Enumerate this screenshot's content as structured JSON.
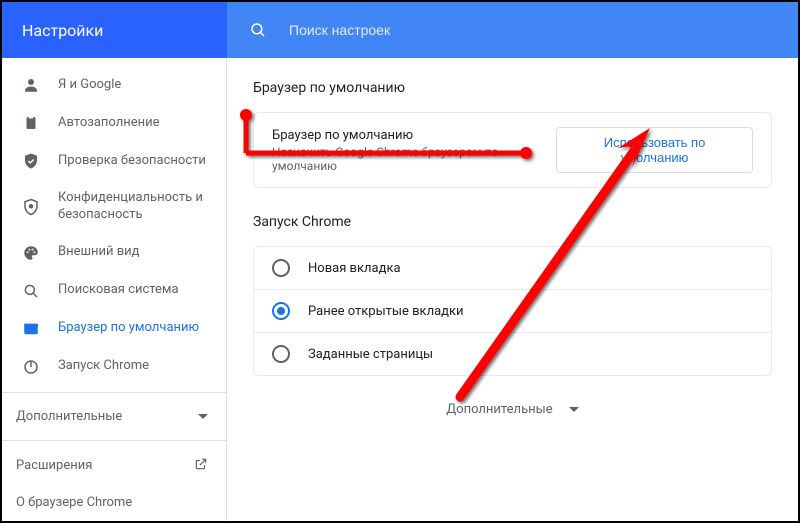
{
  "header": {
    "title": "Настройки",
    "search_placeholder": "Поиск настроек"
  },
  "sidebar": {
    "items": [
      {
        "label": "Я и Google",
        "icon": "person"
      },
      {
        "label": "Автозаполнение",
        "icon": "clipboard"
      },
      {
        "label": "Проверка безопасности",
        "icon": "shield-check"
      },
      {
        "label": "Конфиденциальность и безопасность",
        "icon": "shield"
      },
      {
        "label": "Внешний вид",
        "icon": "palette"
      },
      {
        "label": "Поисковая система",
        "icon": "search"
      },
      {
        "label": "Браузер по умолчанию",
        "icon": "browser",
        "active": true
      },
      {
        "label": "Запуск Chrome",
        "icon": "power"
      }
    ],
    "advanced_label": "Дополнительные",
    "extensions_label": "Расширения",
    "about_label": "О браузере Chrome"
  },
  "main": {
    "default_browser": {
      "section_title": "Браузер по умолчанию",
      "row_title": "Браузер по умолчанию",
      "row_subtitle": "Назначить Google Chrome браузером по умолчанию",
      "button_label": "Использовать по умолчанию"
    },
    "startup": {
      "section_title": "Запуск Chrome",
      "options": [
        {
          "label": "Новая вкладка",
          "checked": false
        },
        {
          "label": "Ранее открытые вкладки",
          "checked": true
        },
        {
          "label": "Заданные страницы",
          "checked": false
        }
      ]
    },
    "advanced_label": "Дополнительные"
  }
}
